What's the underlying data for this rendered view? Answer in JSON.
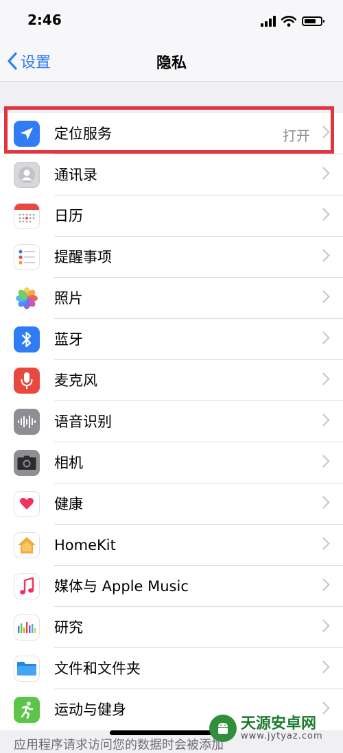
{
  "status_bar": {
    "time": "2:46"
  },
  "nav": {
    "back_label": "设置",
    "title": "隐私"
  },
  "items": [
    {
      "label": "定位服务",
      "value": "打开",
      "icon": "location-arrow-icon"
    },
    {
      "label": "通讯录",
      "icon": "contacts-icon"
    },
    {
      "label": "日历",
      "icon": "calendar-icon"
    },
    {
      "label": "提醒事项",
      "icon": "reminders-icon"
    },
    {
      "label": "照片",
      "icon": "photos-icon"
    },
    {
      "label": "蓝牙",
      "icon": "bluetooth-icon"
    },
    {
      "label": "麦克风",
      "icon": "microphone-icon"
    },
    {
      "label": "语音识别",
      "icon": "speech-recognition-icon"
    },
    {
      "label": "相机",
      "icon": "camera-icon"
    },
    {
      "label": "健康",
      "icon": "health-heart-icon"
    },
    {
      "label": "HomeKit",
      "icon": "homekit-house-icon"
    },
    {
      "label": "媒体与 Apple Music",
      "icon": "music-note-icon"
    },
    {
      "label": "研究",
      "icon": "research-icon"
    },
    {
      "label": "文件和文件夹",
      "icon": "folder-icon"
    },
    {
      "label": "运动与健身",
      "icon": "fitness-runner-icon"
    }
  ],
  "footer_note": "应用程序请求访问您的数据时会被添加",
  "watermark": {
    "title": "天源安卓网",
    "url": "www.jytyaz.com"
  },
  "colors": {
    "accent": "#2f7cf6",
    "highlight": "#e0343f",
    "background": "#efeff4"
  }
}
